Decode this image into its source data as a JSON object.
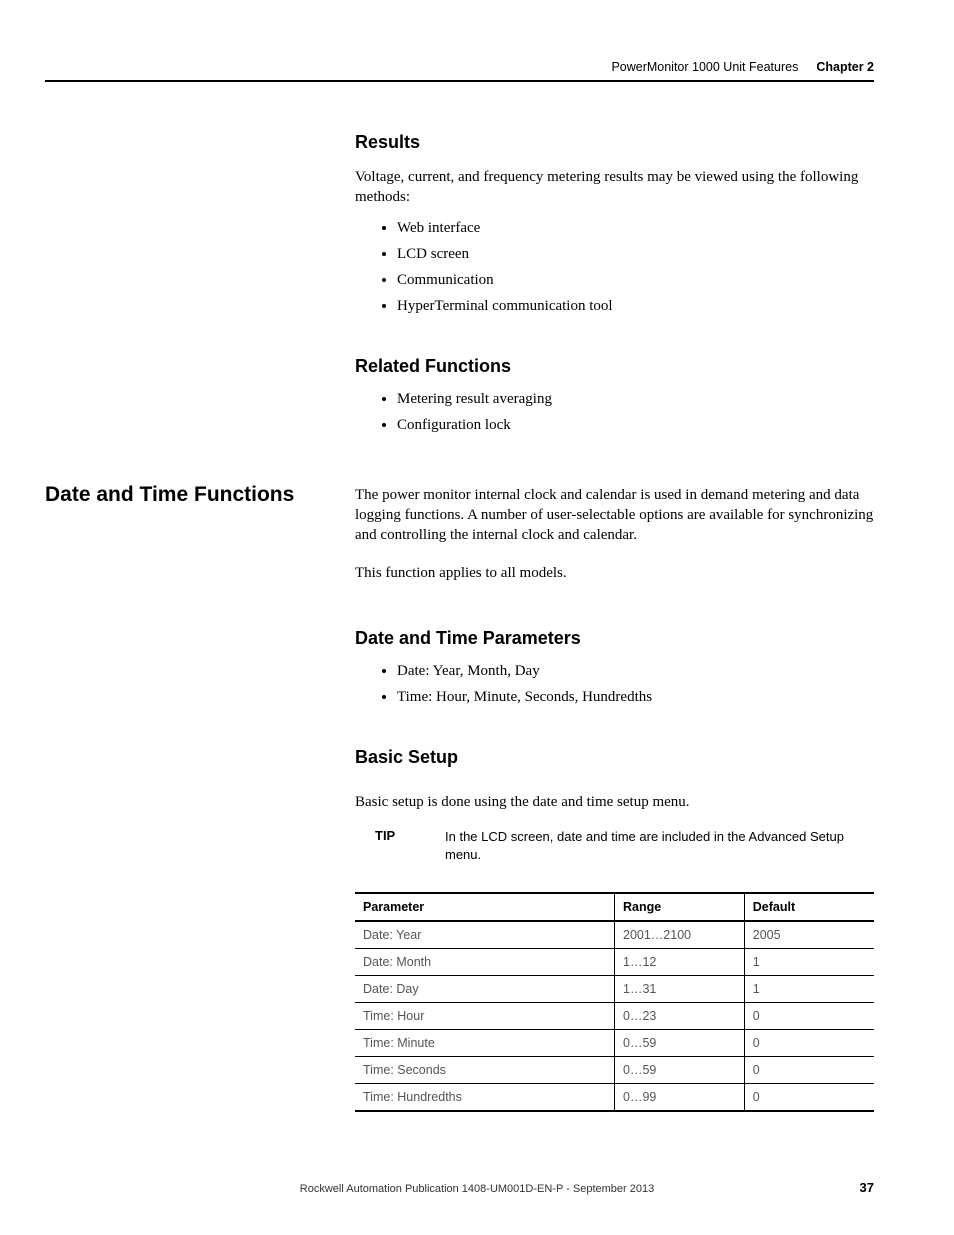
{
  "header": {
    "title": "PowerMonitor 1000 Unit Features",
    "chapter": "Chapter 2"
  },
  "sections": {
    "results": {
      "heading": "Results",
      "intro": "Voltage, current, and frequency metering results may be viewed using the following methods:",
      "items": [
        "Web interface",
        "LCD screen",
        "Communication",
        "HyperTerminal communication tool"
      ]
    },
    "related": {
      "heading": "Related Functions",
      "items": [
        "Metering result averaging",
        "Configuration lock"
      ]
    },
    "datetime": {
      "sidebar": "Date and Time Functions",
      "para1": "The power monitor internal clock and calendar is used in demand metering and data logging functions. A number of user-selectable options are available for synchronizing and controlling the internal clock and calendar.",
      "para2": "This function applies to all models."
    },
    "dtparams": {
      "heading": "Date and Time Parameters",
      "items": [
        "Date: Year, Month, Day",
        "Time: Hour, Minute, Seconds, Hundredths"
      ]
    },
    "basic": {
      "heading": "Basic Setup",
      "intro": "Basic setup is done using the date and time setup menu."
    },
    "tip": {
      "label": "TIP",
      "text": "In the LCD screen, date and time are included in the Advanced Setup menu."
    }
  },
  "table": {
    "headers": {
      "param": "Parameter",
      "range": "Range",
      "default": "Default"
    },
    "rows": [
      {
        "param": "Date: Year",
        "range": "2001…2100",
        "default": "2005"
      },
      {
        "param": "Date: Month",
        "range": "1…12",
        "default": "1"
      },
      {
        "param": "Date: Day",
        "range": "1…31",
        "default": "1"
      },
      {
        "param": "Time: Hour",
        "range": "0…23",
        "default": "0"
      },
      {
        "param": "Time: Minute",
        "range": "0…59",
        "default": "0"
      },
      {
        "param": "Time: Seconds",
        "range": "0…59",
        "default": "0"
      },
      {
        "param": "Time: Hundredths",
        "range": "0…99",
        "default": "0"
      }
    ]
  },
  "footer": {
    "pub": "Rockwell Automation Publication 1408-UM001D-EN-P - September 2013",
    "page": "37"
  }
}
